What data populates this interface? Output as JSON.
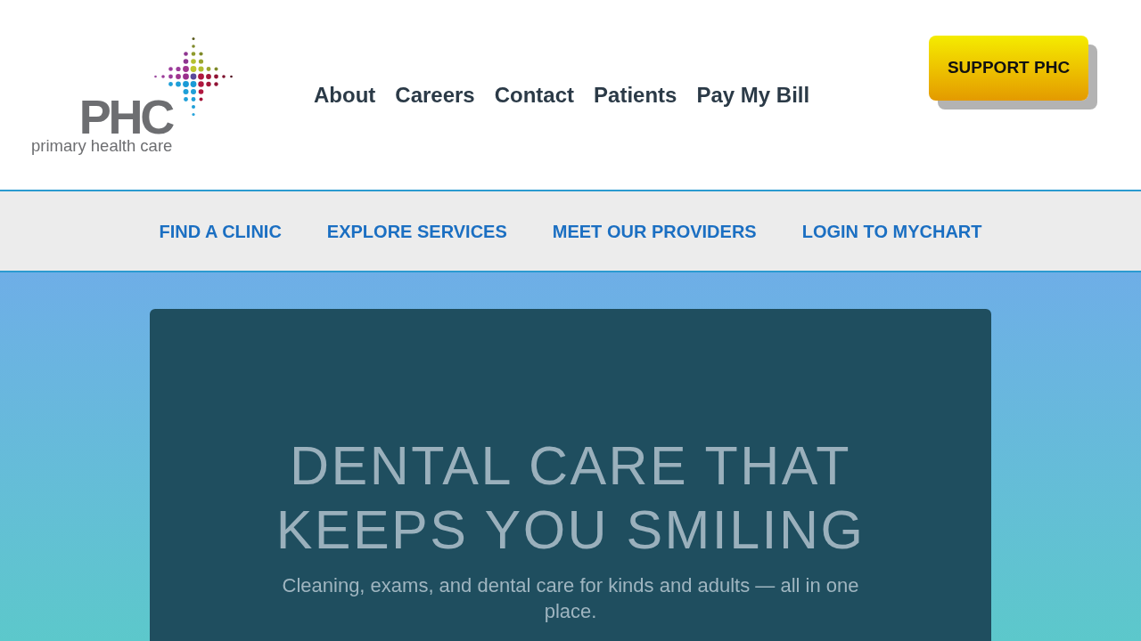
{
  "logo": {
    "wordmark": "PHC",
    "tagline": "primary health care"
  },
  "main_nav": [
    "About",
    "Careers",
    "Contact",
    "Patients",
    "Pay My Bill"
  ],
  "support_button": "SUPPORT PHC",
  "quick_links": [
    "FIND A CLINIC",
    "EXPLORE SERVICES",
    "MEET OUR PROVIDERS",
    "LOGIN TO MYCHART"
  ],
  "hero": {
    "heading": "DENTAL CARE THAT KEEPS YOU SMILING",
    "subheading": "Cleaning, exams, and dental care for kinds and adults — all in one place."
  }
}
